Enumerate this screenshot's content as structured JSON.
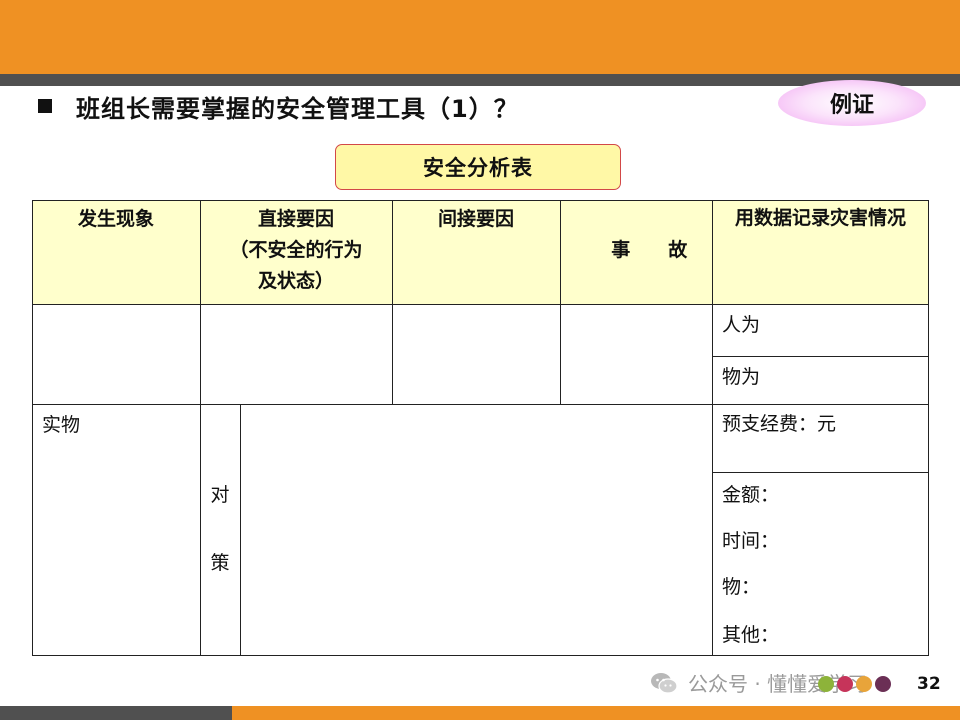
{
  "slide": {
    "title": "班组长需要掌握的安全管理工具（1）？",
    "badge": "例证",
    "table_title": "安全分析表",
    "page_number": "32",
    "colors": {
      "accent": "#EF9123",
      "stripe": "#505050",
      "header_fill": "#FFFFCC",
      "title_fill": "#FFF8A6"
    }
  },
  "table": {
    "headers": {
      "col1": "发生现象",
      "col2_line1": "直接要因",
      "col2_line2": "（不安全的行为",
      "col2_line3": "及状态）",
      "col3": "间接要因",
      "col4": "事　　故",
      "col5": "用数据记录灾害情况"
    },
    "row1": {
      "human": "人为",
      "object": "物为"
    },
    "row2": {
      "phenomenon": "实物",
      "measure_char1": "对",
      "measure_char2": "策",
      "budget": "预支经费：元",
      "amount": "金额：",
      "time": "时间：",
      "thing": "物：",
      "other": "其他："
    }
  },
  "watermark": {
    "icon": "wechat-icon",
    "text": "公众号 · 懂懂爱学习",
    "dot_colors": [
      "#8DB33A",
      "#C6345A",
      "#E8A43A",
      "#6B2F55"
    ]
  }
}
